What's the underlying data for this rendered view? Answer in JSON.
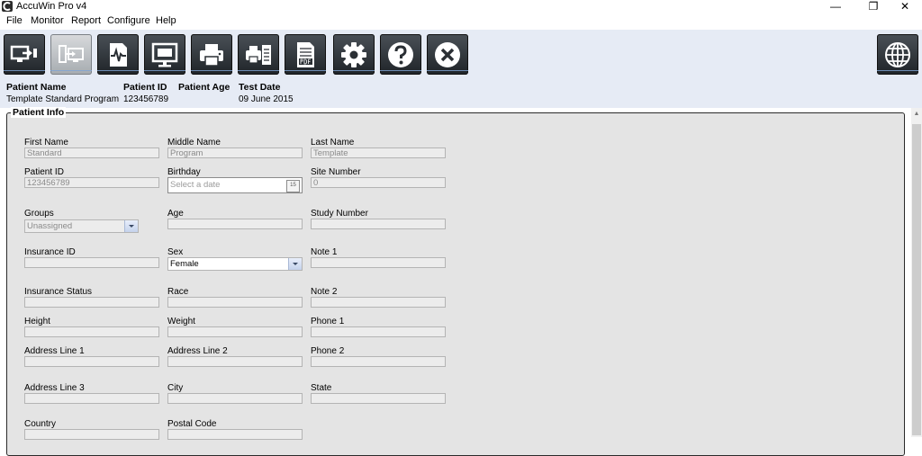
{
  "window": {
    "title": "AccuWin Pro v4",
    "minimize_glyph": "—",
    "restore_glyph": "❐",
    "close_glyph": "✕"
  },
  "menu": [
    "File",
    "Monitor",
    "Report",
    "Configure",
    "Help"
  ],
  "toolbar": {
    "buttons": [
      {
        "icon": "monitor-transfer-icon",
        "active": false
      },
      {
        "icon": "device-monitor-icon",
        "active": true
      },
      {
        "icon": "waveform-report-icon",
        "active": false
      },
      {
        "icon": "screen-display-icon",
        "active": false
      },
      {
        "icon": "printer-icon",
        "active": false
      },
      {
        "icon": "print-report-icon",
        "active": false
      },
      {
        "icon": "pdf-document-icon",
        "active": false
      },
      {
        "icon": "gear-icon",
        "active": false
      },
      {
        "icon": "help-icon",
        "active": false
      },
      {
        "icon": "close-circle-icon",
        "active": false
      },
      {
        "icon": "globe-icon",
        "active": false
      }
    ]
  },
  "patient_bar": {
    "name_label": "Patient Name",
    "name_value": "Template Standard Program",
    "id_label": "Patient ID",
    "id_value": "123456789",
    "age_label": "Patient Age",
    "age_value": "",
    "test_date_label": "Test Date",
    "test_date_value": "09 June 2015"
  },
  "patient_info": {
    "legend": "Patient Info",
    "fields": {
      "first_name": {
        "label": "First Name",
        "value": "Standard"
      },
      "middle_name": {
        "label": "Middle Name",
        "value": "Program"
      },
      "last_name": {
        "label": "Last Name",
        "value": "Template"
      },
      "patient_id": {
        "label": "Patient ID",
        "value": "123456789"
      },
      "birthday": {
        "label": "Birthday",
        "placeholder": "Select a date",
        "calendar_glyph": "15"
      },
      "site_number": {
        "label": "Site Number",
        "value": "0"
      },
      "groups": {
        "label": "Groups",
        "value": "Unassigned"
      },
      "age": {
        "label": "Age",
        "value": ""
      },
      "study_number": {
        "label": "Study Number",
        "value": ""
      },
      "insurance_id": {
        "label": "Insurance ID",
        "value": ""
      },
      "sex": {
        "label": "Sex",
        "value": "Female"
      },
      "note1": {
        "label": "Note 1",
        "value": ""
      },
      "insurance_status": {
        "label": "Insurance Status",
        "value": ""
      },
      "race": {
        "label": "Race",
        "value": ""
      },
      "note2": {
        "label": "Note 2",
        "value": ""
      },
      "height": {
        "label": "Height",
        "value": ""
      },
      "weight": {
        "label": "Weight",
        "value": ""
      },
      "phone1": {
        "label": "Phone 1",
        "value": ""
      },
      "address1": {
        "label": "Address Line 1",
        "value": ""
      },
      "address2": {
        "label": "Address Line 2",
        "value": ""
      },
      "phone2": {
        "label": "Phone 2",
        "value": ""
      },
      "address3": {
        "label": "Address Line 3",
        "value": ""
      },
      "city": {
        "label": "City",
        "value": ""
      },
      "state": {
        "label": "State",
        "value": ""
      },
      "country": {
        "label": "Country",
        "value": ""
      },
      "postal_code": {
        "label": "Postal Code",
        "value": ""
      }
    }
  }
}
